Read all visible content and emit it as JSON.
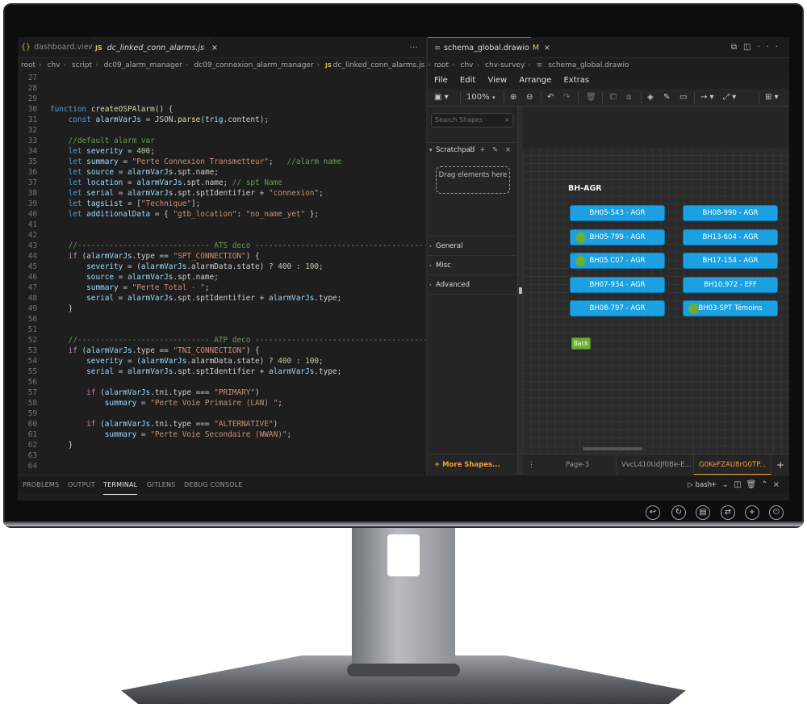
{
  "editor": {
    "tabs": [
      {
        "label": "dashboard.view",
        "icon": "json-icon"
      },
      {
        "label": "dc_linked_conn_alarms.js",
        "icon": "js-icon",
        "close": "×"
      }
    ],
    "more": "···",
    "breadcrumbs": [
      "root",
      "chv",
      "script",
      "dc09_alarm_manager",
      "dc09_connexion_alarm_manager",
      "dc_linked_conn_alarms.js",
      "..."
    ],
    "lines": [
      {
        "n": "27",
        "t": ""
      },
      {
        "n": "28",
        "t": ""
      },
      {
        "n": "29",
        "t": ""
      },
      {
        "n": "30",
        "t": "function createOSPAlarm() {"
      },
      {
        "n": "31",
        "t": "    const alarmVarJs = JSON.parse(trig.content);"
      },
      {
        "n": "32",
        "t": ""
      },
      {
        "n": "33",
        "t": "    //default alarm var"
      },
      {
        "n": "34",
        "t": "    let severity = 400;"
      },
      {
        "n": "35",
        "t": "    let summary = \"Perte Connexion Transmetteur\";   //alarm name"
      },
      {
        "n": "36",
        "t": "    let source = alarmVarJs.spt.name;"
      },
      {
        "n": "37",
        "t": "    let location = alarmVarJs.spt.name; // spt Name"
      },
      {
        "n": "38",
        "t": "    let serial = alarmVarJs.spt.sptIdentifier + \"connexion\";"
      },
      {
        "n": "39",
        "t": "    let tagsList = [\"Technique\"];"
      },
      {
        "n": "40",
        "t": "    let additionalData = { \"gtb_location\": \"no_name_yet\" };"
      },
      {
        "n": "41",
        "t": ""
      },
      {
        "n": "42",
        "t": ""
      },
      {
        "n": "43",
        "t": "    //----------------------------- ATS deco ----------------------------------------"
      },
      {
        "n": "44",
        "t": "    if (alarmVarJs.type == \"SPT_CONNECTION\") {"
      },
      {
        "n": "45",
        "t": "        severity = (alarmVarJs.alarmData.state) ? 400 : 100;"
      },
      {
        "n": "46",
        "t": "        source = alarmVarJs.spt.name;"
      },
      {
        "n": "47",
        "t": "        summary = \"Perte Total - \";"
      },
      {
        "n": "48",
        "t": "        serial = alarmVarJs.spt.sptIdentifier + alarmVarJs.type;"
      },
      {
        "n": "49",
        "t": "    }"
      },
      {
        "n": "50",
        "t": ""
      },
      {
        "n": "51",
        "t": ""
      },
      {
        "n": "52",
        "t": "    //----------------------------- ATP deco ----------------------------------------"
      },
      {
        "n": "53",
        "t": "    if (alarmVarJs.type == \"TNI_CONNECTION\") {"
      },
      {
        "n": "54",
        "t": "        severity = (alarmVarJs.alarmData.state) ? 400 : 100;"
      },
      {
        "n": "55",
        "t": "        serial = alarmVarJs.spt.sptIdentifier + alarmVarJs.type;"
      },
      {
        "n": "56",
        "t": ""
      },
      {
        "n": "57",
        "t": "        if (alarmVarJs.tni.type === \"PRIMARY\")"
      },
      {
        "n": "58",
        "t": "            summary = \"Perte Voie Primaire (LAN) \";"
      },
      {
        "n": "59",
        "t": ""
      },
      {
        "n": "60",
        "t": "        if (alarmVarJs.tni.type === \"ALTERNATIVE\")"
      },
      {
        "n": "61",
        "t": "            summary = \"Perte Voie Secondaire (WWAN)\";"
      },
      {
        "n": "62",
        "t": "    }"
      },
      {
        "n": "63",
        "t": ""
      },
      {
        "n": "64",
        "t": ""
      }
    ]
  },
  "panel": {
    "tabs": [
      "PROBLEMS",
      "OUTPUT",
      "TERMINAL",
      "GITLENS",
      "DEBUG CONSOLE"
    ],
    "active": "TERMINAL",
    "shell": "bash"
  },
  "drawio": {
    "tab_label": "schema_global.drawio",
    "tab_modified": "M",
    "tab_close": "×",
    "breadcrumbs": [
      "root",
      "chv",
      "chv-survey",
      "schema_global.drawio"
    ],
    "menu": [
      "File",
      "Edit",
      "View",
      "Arrange",
      "Extras"
    ],
    "zoom": "100%",
    "search_placeholder": "Search Shapes",
    "scratchpad_label": "Scratchpad",
    "scratchpad_icons": "? + ✎ ×",
    "dropzone_text": "Drag elements here",
    "sections": [
      "General",
      "Misc",
      "Advanced"
    ],
    "more_shapes": "+ More Shapes...",
    "group_label": "BH-AGR",
    "nodes_left": [
      {
        "label": "BH05-543 - AGR",
        "dot": false
      },
      {
        "label": "BH05-799 - AGR",
        "dot": true
      },
      {
        "label": "BH05.C07 - AGR",
        "dot": true
      },
      {
        "label": "BH07-934 - AGR",
        "dot": false
      },
      {
        "label": "BH08-797 - AGR",
        "dot": false
      }
    ],
    "nodes_right": [
      {
        "label": "BH08-990 - AGR",
        "dot": false
      },
      {
        "label": "BH13-604 - AGR",
        "dot": false
      },
      {
        "label": "BH17-154 - AGR",
        "dot": false
      },
      {
        "label": "BH10.972 - EFF",
        "dot": false
      },
      {
        "label": "BH03-SPT Témoins",
        "dot": true
      }
    ],
    "back_label": "Back",
    "pages": [
      "Page-3",
      "VvcL410UdJf0Be-E...",
      "G0KeFZAU8rG0TP..."
    ],
    "active_page": "G0KeFZAU8rG0TP...",
    "add_page": "+"
  },
  "colors": {
    "node_fill": "#1ba1e2",
    "status_dot": "#6aae33",
    "accent_orange": "#f0a030"
  }
}
